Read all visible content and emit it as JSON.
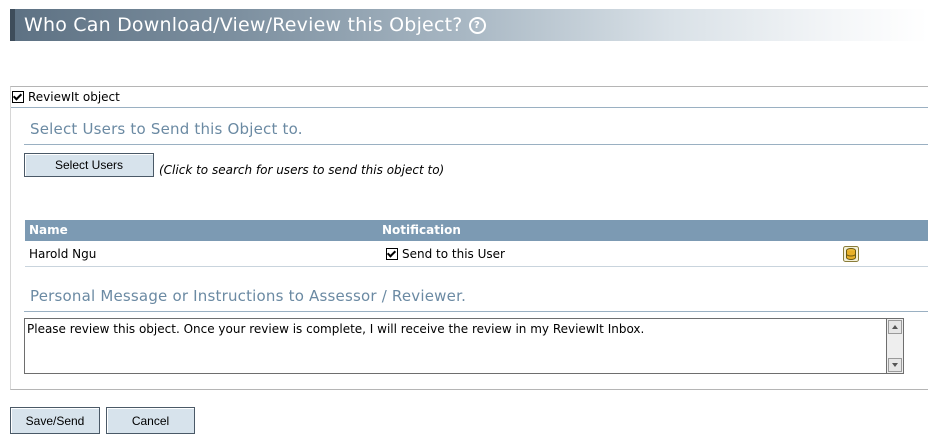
{
  "header": {
    "title": "Who Can Download/View/Review this Object?",
    "help_icon": "help-circle-icon"
  },
  "review_checkbox": {
    "label": "ReviewIt object",
    "checked": true
  },
  "select_section": {
    "title": "Select Users to Send this Object to.",
    "select_button": "Select Users",
    "hint": "(Click to search for users to send this object to)"
  },
  "table": {
    "columns": [
      "Name",
      "Notification"
    ],
    "rows": [
      {
        "name": "Harold Ngu",
        "notification_label": "Send to this User",
        "notification_checked": true,
        "action_icon": "database-icon"
      }
    ]
  },
  "message_section": {
    "title": "Personal Message or Instructions to Assessor / Reviewer.",
    "value": "Please review this object.  Once your review is complete, I will receive the review in my ReviewIt Inbox."
  },
  "footer": {
    "save_label": "Save/Send",
    "cancel_label": "Cancel"
  },
  "colors": {
    "header_dark": "#3e4d5b",
    "section_title": "#6b8aa3",
    "table_header": "#7c9ab3",
    "button_bg": "#d7e3ec"
  }
}
